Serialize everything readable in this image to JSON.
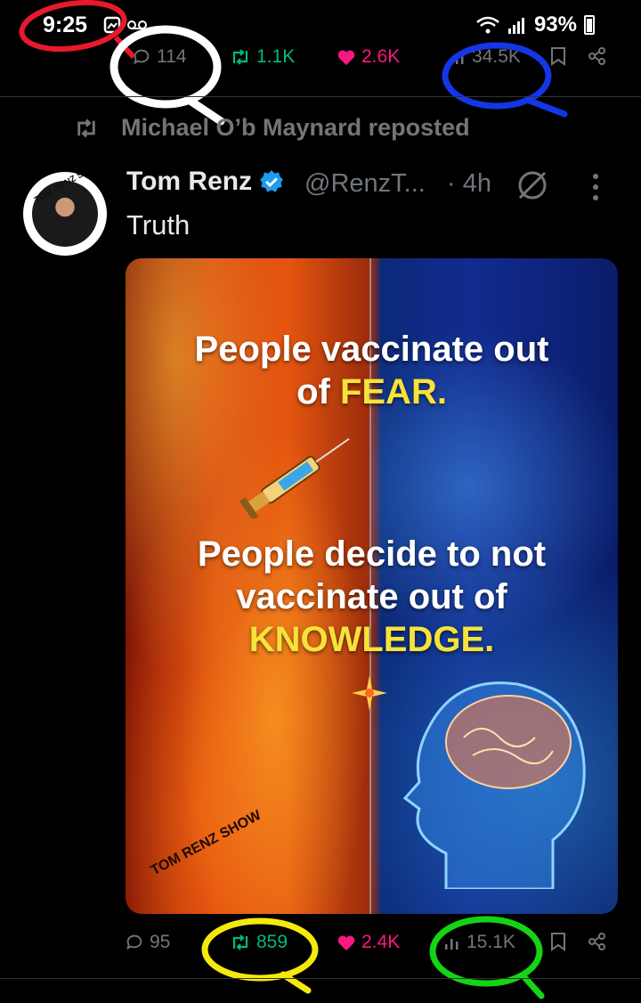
{
  "status_bar": {
    "time": "9:25",
    "battery": "93%"
  },
  "top_actions": {
    "replies": "114",
    "reposts": "1.1K",
    "likes": "2.6K",
    "views": "34.5K"
  },
  "repost_label": "Michael O’b Maynard reposted",
  "post": {
    "author_name": "Tom Renz",
    "handle": "@RenzT...",
    "age": "· 4h",
    "text": "Truth",
    "image": {
      "line1a": "People vaccinate out",
      "line1b": "of ",
      "line1_highlight": "FEAR.",
      "line2a": "People decide to not",
      "line2b": "vaccinate out of",
      "line2_highlight": "KNOWLEDGE.",
      "watermark": "TOM RENZ SHOW"
    },
    "avatar_text": "TOM RENZ SHOW",
    "actions": {
      "replies": "95",
      "reposts": "859",
      "likes": "2.4K",
      "views": "15.1K"
    }
  },
  "colors": {
    "background": "#000000",
    "muted": "#71767b",
    "repost_green": "#00ba7c",
    "like_pink": "#f91880",
    "verified_blue": "#1d9bf0",
    "highlight_yellow": "#f7e23a"
  }
}
